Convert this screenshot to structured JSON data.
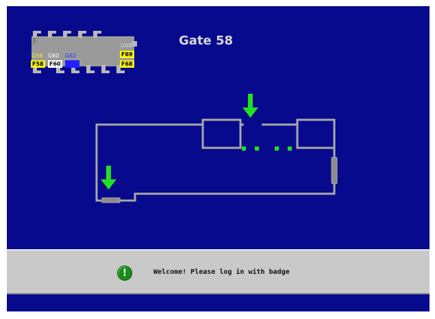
{
  "header": {
    "gate_title": "Gate 58"
  },
  "minimap": {
    "section_letter": "F",
    "gates_top": [
      {
        "label": "G58",
        "color": "yellow"
      },
      {
        "label": "G60",
        "color": "white"
      },
      {
        "label": "G62",
        "color": "blue"
      },
      {
        "label": "G69",
        "color": "lgray"
      }
    ],
    "gates_bottom": [
      {
        "label": "F58",
        "color": "yellow"
      },
      {
        "label": "F60",
        "color": "white"
      },
      {
        "label": "F62",
        "color": "blue"
      },
      {
        "label": "F69",
        "color": "yellow"
      },
      {
        "label": "F68",
        "color": "yellow"
      }
    ]
  },
  "map": {
    "wall_color": "#a8a8a8",
    "marker_color": "#21e021",
    "arrow_color": "#21e021",
    "icons": [
      "down-arrow-icon",
      "down-arrow-icon"
    ]
  },
  "status": {
    "icon": "exclamation-icon",
    "message": "Welcome! Please log in with badge"
  },
  "colors": {
    "background": "#070a8c",
    "status_bar": "#c9c9c9",
    "alert_green": "#1a8c1a"
  }
}
